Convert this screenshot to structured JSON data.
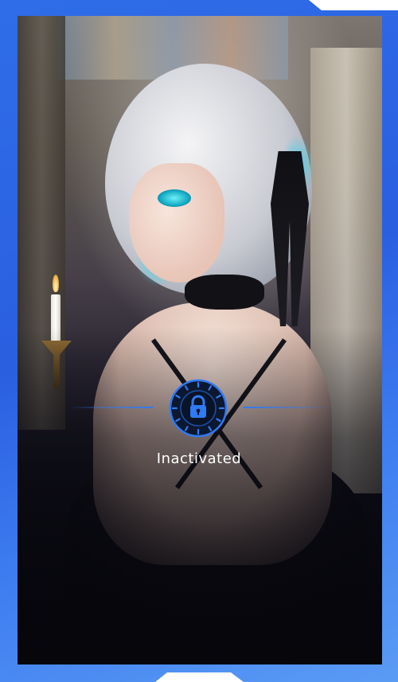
{
  "status": {
    "label": "Inactivated",
    "icon": "lock-icon"
  },
  "colors": {
    "frame": "#2f6de8",
    "accent": "#2f7af5",
    "text": "#ffffff"
  }
}
